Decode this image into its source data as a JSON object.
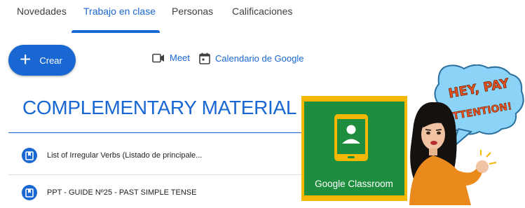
{
  "tabs": [
    {
      "label": "Novedades",
      "active": false
    },
    {
      "label": "Trabajo en clase",
      "active": true
    },
    {
      "label": "Personas",
      "active": false
    },
    {
      "label": "Calificaciones",
      "active": false
    }
  ],
  "toolbar": {
    "create_icon": "plus-icon",
    "create_label": "Crear",
    "meet_icon": "video-camera-icon",
    "meet_label": "Meet",
    "calendar_icon": "calendar-icon",
    "calendar_label": "Calendario de Google"
  },
  "section": {
    "title": "COMPLEMENTARY MATERIAL",
    "items": [
      {
        "label": "List of Irregular Verbs (Listado de principale...",
        "icon": "material-bookmark-icon"
      },
      {
        "label": "PPT - GUIDE Nº25 - PAST SIMPLE TENSE",
        "icon": "material-bookmark-icon"
      }
    ]
  },
  "logo": {
    "label": "Google Classroom",
    "border_color": "#f5b800",
    "board_color": "#1e8e3e"
  },
  "bitmoji": {
    "speech_text": "HEY, PAY ATTENTION!",
    "bubble_color": "#8bd3f7",
    "text_color": "#e8531f"
  },
  "colors": {
    "accent": "#1967d2",
    "text": "#202124",
    "divider": "#dadce0"
  }
}
